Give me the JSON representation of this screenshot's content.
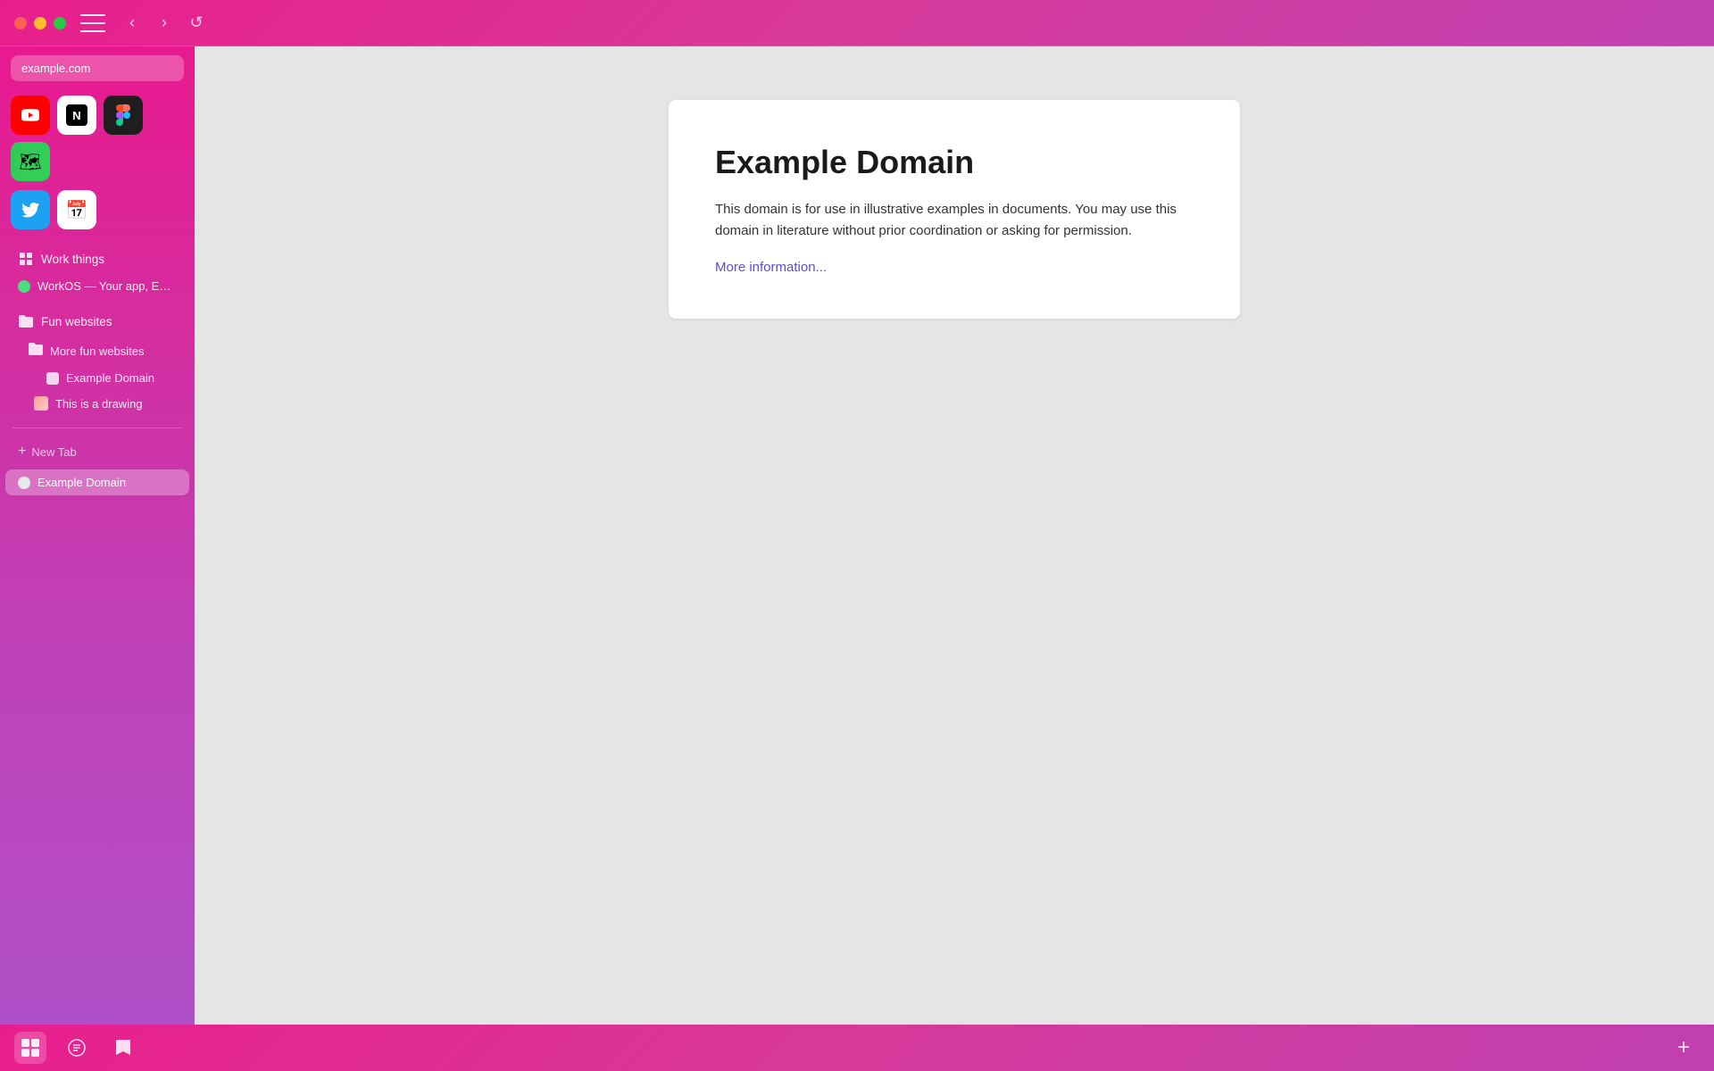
{
  "window": {
    "title": "Example Domain"
  },
  "topbar": {
    "back_label": "‹",
    "forward_label": "›",
    "reload_label": "↺"
  },
  "sidebar": {
    "address_bar": {
      "text": "example.com"
    },
    "bookmarks_row1": [
      {
        "id": "youtube",
        "label": "YouTube",
        "icon": "▶"
      },
      {
        "id": "notion",
        "label": "Notion",
        "icon": "N"
      },
      {
        "id": "figma",
        "label": "Figma",
        "icon": "✦"
      },
      {
        "id": "maps",
        "label": "Maps",
        "icon": "📍"
      }
    ],
    "bookmarks_row2": [
      {
        "id": "twitter",
        "label": "Twitter",
        "icon": "𝕏"
      },
      {
        "id": "calendar",
        "label": "Calendar",
        "icon": "📅"
      }
    ],
    "groups": [
      {
        "id": "work-things",
        "label": "Work things",
        "icon": "grid"
      }
    ],
    "workos_item": {
      "label": "WorkOS — Your app, En..."
    },
    "fun_websites": {
      "label": "Fun websites"
    },
    "more_fun_websites": {
      "label": "More fun websites"
    },
    "example_domain_bookmark": {
      "label": "Example Domain"
    },
    "drawing_item": {
      "label": "This is a drawing"
    },
    "new_tab": {
      "label": "New Tab"
    },
    "active_tab": {
      "label": "Example Domain"
    }
  },
  "content": {
    "title": "Example Domain",
    "body": "This domain is for use in illustrative examples in documents. You may use this domain in literature without prior coordination or asking for permission.",
    "link_text": "More information...",
    "link_url": "https://www.iana.org/domains/reserved"
  },
  "bottom_bar": {
    "items": [
      {
        "id": "history",
        "icon": "🕐"
      },
      {
        "id": "reader",
        "icon": "⊞"
      },
      {
        "id": "bookmarks",
        "icon": "🗃"
      },
      {
        "id": "add",
        "icon": "+"
      }
    ]
  }
}
